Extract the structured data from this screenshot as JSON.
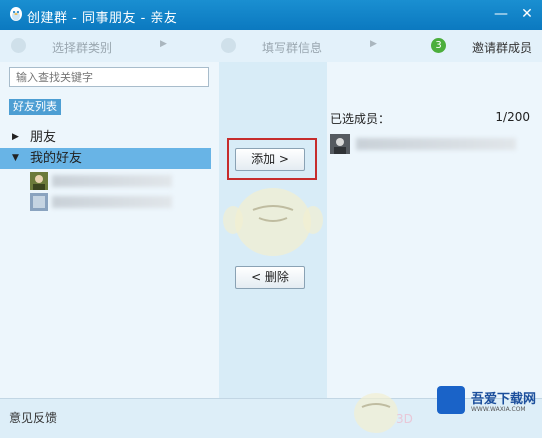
{
  "window": {
    "title": "创建群 - 同事朋友 - 亲友",
    "minimize_glyph": "—",
    "close_glyph": "✕"
  },
  "steps": [
    {
      "label": "选择群类别",
      "number": "",
      "active": false
    },
    {
      "label": "填写群信息",
      "number": "",
      "active": false
    },
    {
      "label": "邀请群成员",
      "number": "3",
      "active": true
    }
  ],
  "left": {
    "search_placeholder": "输入查找关键字",
    "list_tag": "好友列表",
    "groups": [
      {
        "label": "朋友",
        "expanded": false
      },
      {
        "label": "我的好友",
        "expanded": true
      }
    ]
  },
  "center": {
    "add_label": "添加 >",
    "remove_label": "< 删除"
  },
  "right": {
    "selected_label": "已选成员：",
    "count": "1/200"
  },
  "bottom": {
    "feedback": "意见反馈"
  },
  "watermark": {
    "name": "吾爱下载网",
    "url": "WWW.WAXIA.COM"
  }
}
